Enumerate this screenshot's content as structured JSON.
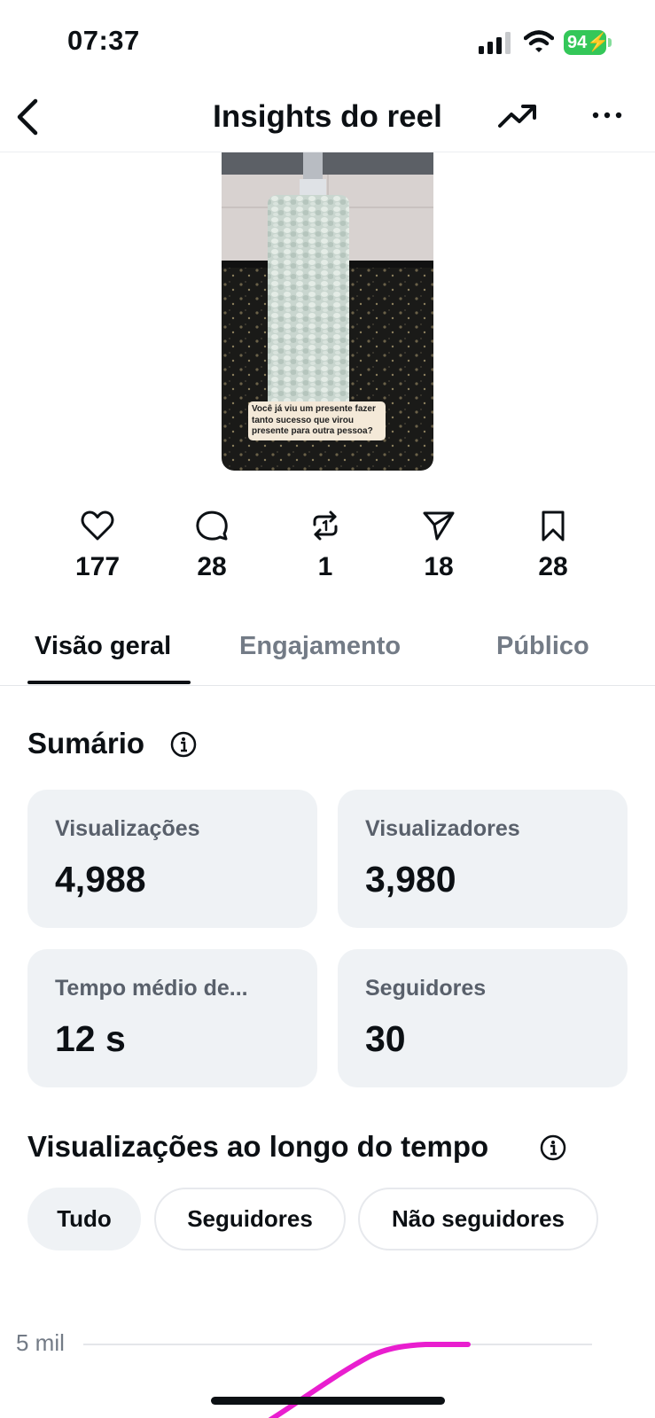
{
  "status_bar": {
    "time": "07:37",
    "battery_percent": "94"
  },
  "header": {
    "title": "Insights do reel",
    "back_icon": "chevron-left-icon",
    "trend_icon": "trending-up-icon",
    "more_icon": "ellipsis-icon"
  },
  "media": {
    "caption": "Você já viu um presente fazer tanto sucesso que virou presente para outra pessoa?"
  },
  "stats": [
    {
      "icon": "heart-icon",
      "value": "177"
    },
    {
      "icon": "comment-icon",
      "value": "28"
    },
    {
      "icon": "repost-icon",
      "value": "1"
    },
    {
      "icon": "share-icon",
      "value": "18"
    },
    {
      "icon": "bookmark-icon",
      "value": "28"
    }
  ],
  "tabs": [
    {
      "label": "Visão geral",
      "active": true
    },
    {
      "label": "Engajamento",
      "active": false
    },
    {
      "label": "Público",
      "active": false
    }
  ],
  "summary": {
    "title": "Sumário",
    "cards": [
      {
        "label": "Visualizações",
        "value": "4,988"
      },
      {
        "label": "Visualizadores",
        "value": "3,980"
      },
      {
        "label": "Tempo médio de...",
        "value": "12 s"
      },
      {
        "label": "Seguidores",
        "value": "30"
      }
    ]
  },
  "views_over_time": {
    "title": "Visualizações ao longo do tempo",
    "filters": [
      {
        "label": "Tudo",
        "selected": true
      },
      {
        "label": "Seguidores",
        "selected": false
      },
      {
        "label": "Não seguidores",
        "selected": false
      }
    ]
  },
  "chart_data": {
    "type": "line",
    "y_tick_labels": [
      "5 mil"
    ],
    "series": [
      {
        "color": "#e91ecf"
      }
    ]
  },
  "colors": {
    "accent_line": "#e91ecf",
    "card_bg": "#eff2f5",
    "muted_text": "#737b86",
    "battery": "#34c759"
  }
}
